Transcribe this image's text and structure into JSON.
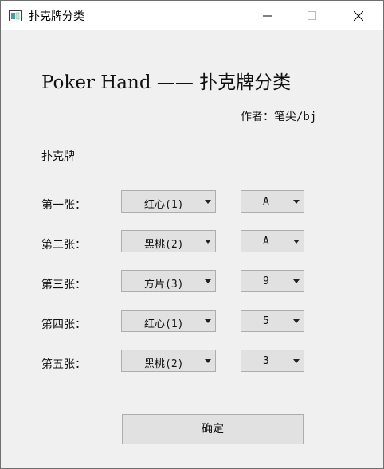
{
  "window": {
    "title": "扑克牌分类"
  },
  "heading": "Poker Hand —— 扑克牌分类",
  "author": "作者：笔尖/bj",
  "section_label": "扑克牌",
  "rows": [
    {
      "label": "第一张：",
      "suit": "红心(1)",
      "rank": "A"
    },
    {
      "label": "第二张：",
      "suit": "黑桃(2)",
      "rank": "A"
    },
    {
      "label": "第三张：",
      "suit": "方片(3)",
      "rank": "9"
    },
    {
      "label": "第四张：",
      "suit": "红心(1)",
      "rank": "5"
    },
    {
      "label": "第五张：",
      "suit": "黑桃(2)",
      "rank": "3"
    }
  ],
  "confirm_label": "确定"
}
